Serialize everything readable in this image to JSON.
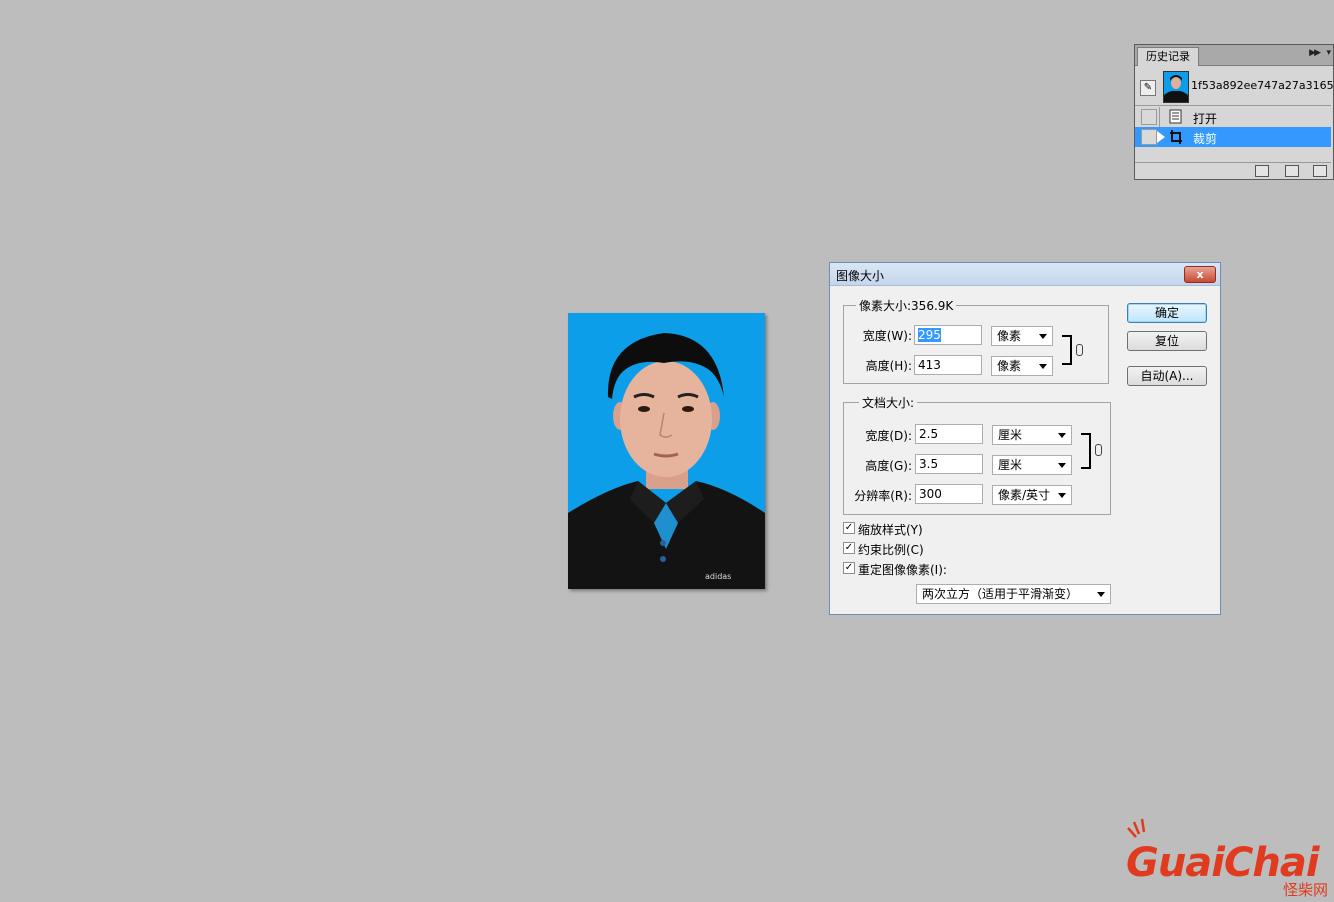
{
  "history_panel": {
    "tab_label": "历史记录",
    "snapshot_label": "1f53a892ee747a27a3165...",
    "steps": [
      {
        "label": "打开",
        "icon": "document-icon",
        "active": false
      },
      {
        "label": "裁剪",
        "icon": "crop-icon",
        "active": true
      }
    ],
    "footer_icons": [
      "new-document-from-state-icon",
      "snapshot-camera-icon",
      "trash-icon"
    ]
  },
  "dialog": {
    "title": "图像大小",
    "close_label": "x",
    "pixel_dimensions": {
      "legend": "像素大小:356.9K",
      "width": {
        "label": "宽度(W):",
        "value": "295",
        "unit": "像素"
      },
      "height": {
        "label": "高度(H):",
        "value": "413",
        "unit": "像素"
      }
    },
    "document_size": {
      "legend": "文档大小:",
      "width": {
        "label": "宽度(D):",
        "value": "2.5",
        "unit": "厘米"
      },
      "height": {
        "label": "高度(G):",
        "value": "3.5",
        "unit": "厘米"
      },
      "resolution": {
        "label": "分辨率(R):",
        "value": "300",
        "unit": "像素/英寸"
      }
    },
    "buttons": {
      "ok": "确定",
      "reset": "复位",
      "auto": "自动(A)..."
    },
    "checkboxes": {
      "scale_styles": {
        "label": "缩放样式(Y)",
        "checked": true
      },
      "constrain_proportions": {
        "label": "约束比例(C)",
        "checked": true
      },
      "resample": {
        "label": "重定图像像素(I):",
        "checked": true
      }
    },
    "resample_method": "两次立方（适用于平滑渐变）"
  },
  "watermark": {
    "brand": "GuaiChai",
    "brand_cn": "怪柴网",
    "color": "#e13b1f"
  },
  "colors": {
    "canvas_bg": "#bdbdbd",
    "photo_bg": "#0c9ee8",
    "selection": "#3399ff"
  }
}
